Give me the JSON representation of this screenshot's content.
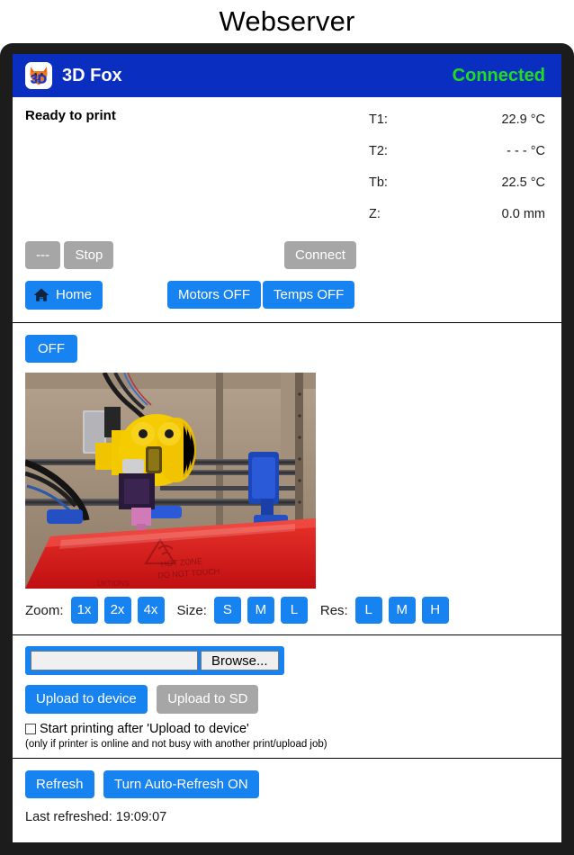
{
  "page": {
    "title": "Webserver"
  },
  "app": {
    "logo_icon": "fox-3d-logo-icon",
    "name": "3D Fox",
    "connection_status": "Connected",
    "connection_color": "#21dd21",
    "header_color": "#0a2ec0"
  },
  "status": {
    "printer_state": "Ready to print",
    "temps": [
      {
        "label": "T1:",
        "value": "22.9 °C"
      },
      {
        "label": "T2:",
        "value": "- - - °C"
      },
      {
        "label": "Tb:",
        "value": "22.5 °C"
      },
      {
        "label": "Z:",
        "value": "0.0 mm"
      }
    ]
  },
  "controls": {
    "pause_label": "---",
    "stop_label": "Stop",
    "connect_label": "Connect",
    "home_label": "Home",
    "home_icon": "house-icon",
    "motors_label": "Motors OFF",
    "temps_label": "Temps OFF"
  },
  "webcam": {
    "toggle_label": "OFF",
    "zoom_label": "Zoom:",
    "zoom_options": [
      "1x",
      "2x",
      "4x"
    ],
    "size_label": "Size:",
    "size_options": [
      "S",
      "M",
      "L"
    ],
    "res_label": "Res:",
    "res_options": [
      "L",
      "M",
      "H"
    ],
    "stream_alt": "3d-printer-webcam-stream"
  },
  "upload": {
    "file_value": "",
    "browse_label": "Browse...",
    "upload_device_label": "Upload to device",
    "upload_sd_label": "Upload to SD",
    "autostart_label": "Start printing after 'Upload to device'",
    "autostart_checked": false,
    "autostart_note": "(only if printer is online and not busy with another print/upload job)"
  },
  "refresh": {
    "refresh_label": "Refresh",
    "autorefresh_label": "Turn Auto-Refresh ON",
    "last_refreshed_text": "Last refreshed: 19:09:07"
  },
  "theme": {
    "accent_blue": "#1783f0",
    "disabled_gray": "#a6a6a6",
    "bezel": "#1c1c1c"
  }
}
